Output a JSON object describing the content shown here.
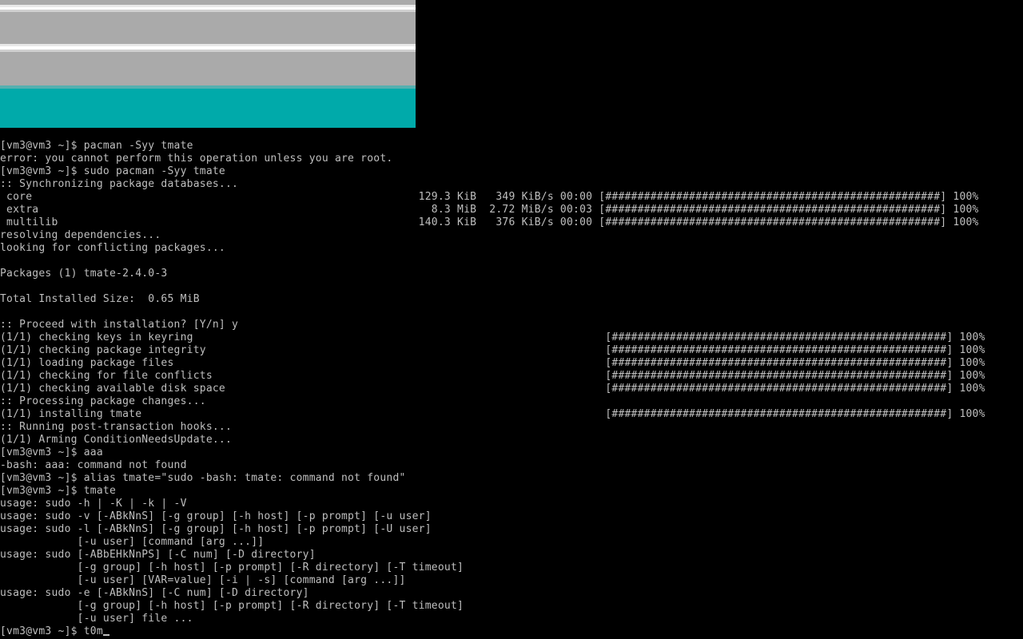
{
  "splash": {
    "colors": {
      "background": "#000000",
      "stripe_white": "#ffffff",
      "stripe_gray": "#aaaaaa",
      "teal": "#00aaaa"
    }
  },
  "terminal": {
    "colors": {
      "background": "#000000",
      "foreground": "#bfbfbf"
    },
    "lines": [
      "[vm3@vm3 ~]$ pacman -Syy tmate",
      "error: you cannot perform this operation unless you are root.",
      "[vm3@vm3 ~]$ sudo pacman -Syy tmate",
      ":: Synchronizing package databases...",
      " core                                                            129.3 KiB   349 KiB/s 00:00 [####################################################] 100%",
      " extra                                                             8.3 MiB  2.72 MiB/s 00:03 [####################################################] 100%",
      " multilib                                                        140.3 KiB   376 KiB/s 00:00 [####################################################] 100%",
      "resolving dependencies...",
      "looking for conflicting packages...",
      "",
      "Packages (1) tmate-2.4.0-3",
      "",
      "Total Installed Size:  0.65 MiB",
      "",
      ":: Proceed with installation? [Y/n] y",
      "(1/1) checking keys in keyring                                                                [####################################################] 100%",
      "(1/1) checking package integrity                                                              [####################################################] 100%",
      "(1/1) loading package files                                                                   [####################################################] 100%",
      "(1/1) checking for file conflicts                                                             [####################################################] 100%",
      "(1/1) checking available disk space                                                           [####################################################] 100%",
      ":: Processing package changes...",
      "(1/1) installing tmate                                                                        [####################################################] 100%",
      ":: Running post-transaction hooks...",
      "(1/1) Arming ConditionNeedsUpdate...",
      "[vm3@vm3 ~]$ aaa",
      "-bash: aaa: command not found",
      "[vm3@vm3 ~]$ alias tmate=\"sudo -bash: tmate: command not found\"",
      "[vm3@vm3 ~]$ tmate",
      "usage: sudo -h | -K | -k | -V",
      "usage: sudo -v [-ABkNnS] [-g group] [-h host] [-p prompt] [-u user]",
      "usage: sudo -l [-ABkNnS] [-g group] [-h host] [-p prompt] [-U user]",
      "            [-u user] [command [arg ...]]",
      "usage: sudo [-ABbEHkNnPS] [-C num] [-D directory]",
      "            [-g group] [-h host] [-p prompt] [-R directory] [-T timeout]",
      "            [-u user] [VAR=value] [-i | -s] [command [arg ...]]",
      "usage: sudo -e [-ABkNnS] [-C num] [-D directory]",
      "            [-g group] [-h host] [-p prompt] [-R directory] [-T timeout]",
      "            [-u user] file ..."
    ],
    "prompt_line": {
      "text": "[vm3@vm3 ~]$ t0m"
    }
  }
}
